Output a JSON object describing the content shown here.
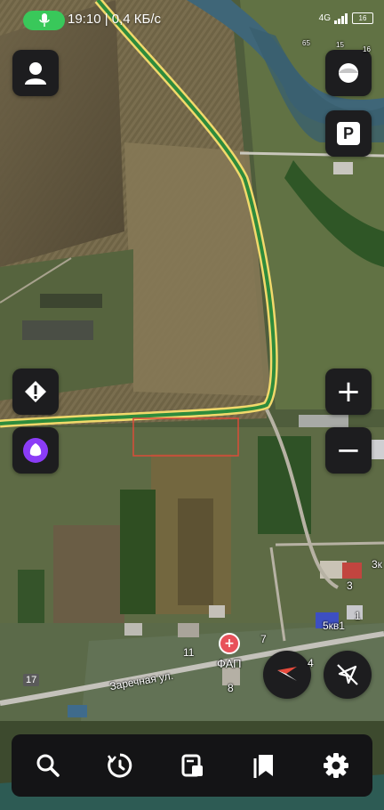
{
  "status": {
    "time_speed": "19:10 | 0,4 КБ/с",
    "network": "4G",
    "battery": "16"
  },
  "map": {
    "poi_label": "ФАП",
    "street_label": "Заречная ул.",
    "house_labels": [
      "11",
      "7",
      "8",
      "4",
      "3",
      "1",
      "5кв1",
      "17",
      "3к"
    ],
    "tiny_labels": [
      "65",
      "15",
      "16"
    ]
  },
  "colors": {
    "accent_purple": "#8b3cf6",
    "route_green": "#2e8b3c",
    "route_yellow": "#f2d96b"
  },
  "icons": {
    "profile": "user-icon",
    "layers": "layers-icon",
    "parking": "P",
    "alert": "alert-icon",
    "alice": "alice-icon",
    "zoom_in": "+",
    "zoom_out": "−",
    "compass": "compass-icon",
    "no_location": "location-off-icon"
  },
  "bottom_nav": [
    "search-icon",
    "history-icon",
    "routes-icon",
    "bookmarks-icon",
    "settings-icon"
  ]
}
